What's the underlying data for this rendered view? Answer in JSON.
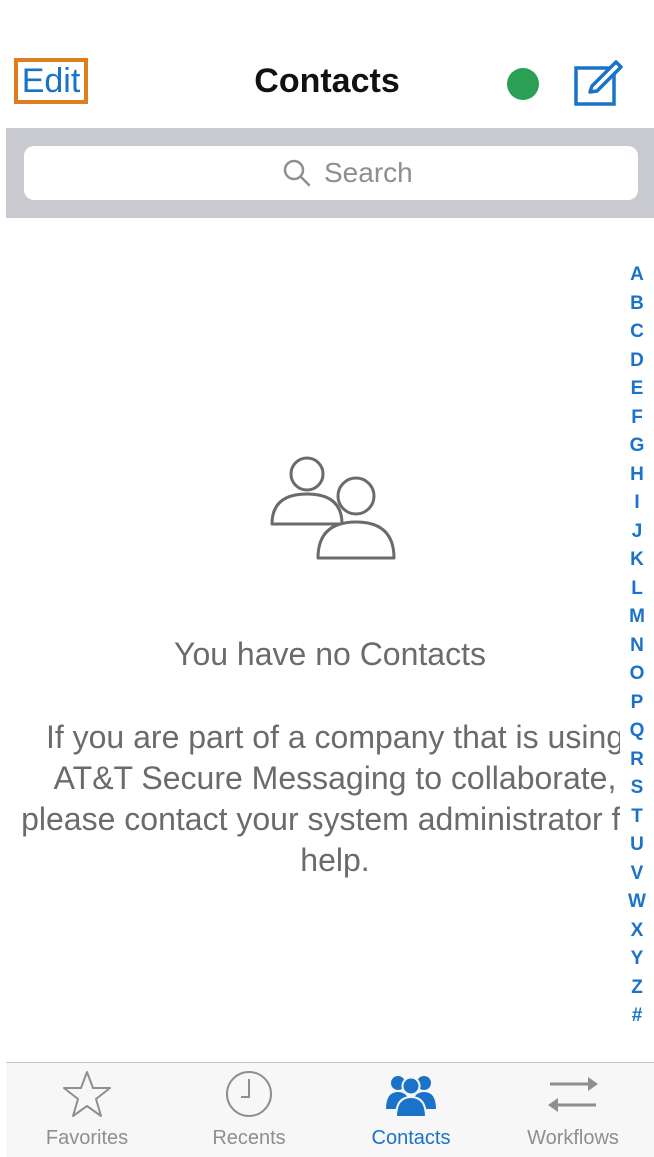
{
  "header": {
    "edit_label": "Edit",
    "title": "Contacts",
    "status_color": "#2aa054",
    "compose_icon": "compose-icon"
  },
  "search": {
    "placeholder": "Search",
    "icon": "search-icon"
  },
  "empty_state": {
    "icon": "contacts-icon",
    "title": "You have no Contacts",
    "message": "If you are part of a company that is using AT&T Secure Messaging to collaborate, please contact your system administrator for help."
  },
  "index": {
    "letters": [
      "A",
      "B",
      "C",
      "D",
      "E",
      "F",
      "G",
      "H",
      "I",
      "J",
      "K",
      "L",
      "M",
      "N",
      "O",
      "P",
      "Q",
      "R",
      "S",
      "T",
      "U",
      "V",
      "W",
      "X",
      "Y",
      "Z",
      "#"
    ]
  },
  "tabs": [
    {
      "label": "Favorites",
      "icon": "star-icon",
      "active": false
    },
    {
      "label": "Recents",
      "icon": "clock-icon",
      "active": false
    },
    {
      "label": "Contacts",
      "icon": "contacts-icon",
      "active": true
    },
    {
      "label": "Workflows",
      "icon": "arrows-icon",
      "active": false
    }
  ],
  "colors": {
    "accent": "#1a73c8",
    "highlight_border": "#e07d1f",
    "text_muted": "#6b6b6b"
  }
}
